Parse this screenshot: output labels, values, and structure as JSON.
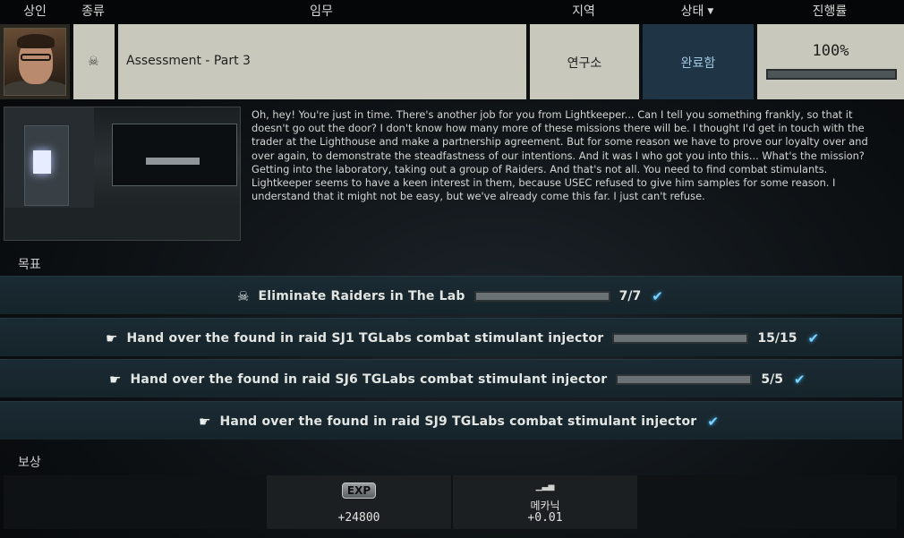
{
  "header": {
    "trader": "상인",
    "type": "종류",
    "mission": "임무",
    "location": "지역",
    "status": "상태",
    "progress": "진행률"
  },
  "quest": {
    "trader_avatar": "trader-portrait",
    "type_icon": "skull-icon",
    "type_icon_glyph": "☠",
    "name": "Assessment - Part 3",
    "location": "연구소",
    "status": "완료함",
    "progress_text": "100%",
    "progress_fraction": 1.0
  },
  "description": "Oh, hey! You're just in time. There's another job for you from Lightkeeper... Can I tell you something frankly, so that it doesn't go out the door? I don't know how many more of these missions there will be. I thought I'd get in touch with the trader at the Lighthouse and make a partnership agreement. But for some reason we have to prove our loyalty over and over again, to demonstrate the steadfastness of our intentions. And it was I who got you into this... What's the mission? Getting into the laboratory, taking out a group of Raiders. And that's not all. You need to find combat stimulants. Lightkeeper seems to have a keen interest in them, because USEC refused to give him samples for some reason. I understand that it might not be easy, but we've already come this far. I just can't refuse.",
  "objectives_label": "목표",
  "objectives": [
    {
      "icon": "skull-icon",
      "glyph": "☠",
      "text": "Eliminate Raiders in The Lab",
      "count": "7/7",
      "fraction": 1.0,
      "has_bar": true,
      "done": true
    },
    {
      "icon": "hand-icon",
      "glyph": "☛",
      "text": "Hand over the found in raid SJ1 TGLabs combat stimulant injector",
      "count": "15/15",
      "fraction": 1.0,
      "has_bar": true,
      "done": true
    },
    {
      "icon": "hand-icon",
      "glyph": "☛",
      "text": "Hand over the found in raid SJ6 TGLabs combat stimulant injector",
      "count": "5/5",
      "fraction": 1.0,
      "has_bar": true,
      "done": true
    },
    {
      "icon": "hand-icon",
      "glyph": "☛",
      "text": "Hand over the found in raid SJ9 TGLabs combat stimulant injector",
      "count": "",
      "fraction": 1.0,
      "has_bar": false,
      "done": true
    }
  ],
  "check_glyph": "✔",
  "rewards_label": "보상",
  "rewards": [
    {
      "icon": "exp-icon",
      "icon_text": "EXP",
      "label": "",
      "value": "+24800"
    },
    {
      "icon": "skill-chart-icon",
      "icon_text": "▁▃▅",
      "label": "메카닉",
      "value": "+0.01"
    }
  ],
  "colors": {
    "status_bg": "#1f3444",
    "status_text": "#9fc6de",
    "check": "#7ed3ff",
    "row_bg": "#c9c8bd"
  }
}
